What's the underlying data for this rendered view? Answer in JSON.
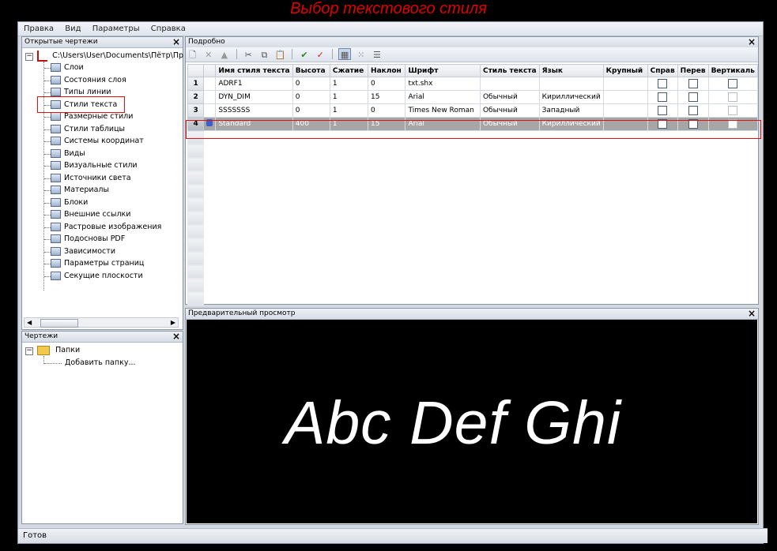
{
  "caption": "Выбор текстового стиля",
  "menu": [
    "Правка",
    "Вид",
    "Параметры",
    "Справка"
  ],
  "left_panel": {
    "title": "Открытые чертежи",
    "root_path": "C:\\Users\\User\\Documents\\Пётр\\Пр",
    "items": [
      {
        "label": "Слои",
        "icon": "layers-icon"
      },
      {
        "label": "Состояния слоя",
        "icon": "layer-states-icon"
      },
      {
        "label": "Типы линии",
        "icon": "linetypes-icon"
      },
      {
        "label": "Стили текста",
        "icon": "text-style-icon"
      },
      {
        "label": "Размерные стили",
        "icon": "dimension-style-icon"
      },
      {
        "label": "Стили таблицы",
        "icon": "table-style-icon"
      },
      {
        "label": "Системы координат",
        "icon": "ucs-icon"
      },
      {
        "label": "Виды",
        "icon": "views-icon"
      },
      {
        "label": "Визуальные стили",
        "icon": "visual-styles-icon"
      },
      {
        "label": "Источники света",
        "icon": "lights-icon"
      },
      {
        "label": "Материалы",
        "icon": "materials-icon"
      },
      {
        "label": "Блоки",
        "icon": "blocks-icon"
      },
      {
        "label": "Внешние ссылки",
        "icon": "xrefs-icon"
      },
      {
        "label": "Растровые изображения",
        "icon": "raster-images-icon"
      },
      {
        "label": "Подосновы PDF",
        "icon": "pdf-underlay-icon"
      },
      {
        "label": "Зависимости",
        "icon": "dependencies-icon"
      },
      {
        "label": "Параметры страниц",
        "icon": "page-setup-icon"
      },
      {
        "label": "Секущие плоскости",
        "icon": "section-planes-icon"
      }
    ]
  },
  "drawings_panel": {
    "title": "Чертежи",
    "folder": "Папки",
    "add_folder": "Добавить папку..."
  },
  "detail_panel": {
    "title": "Подробно",
    "columns": [
      "Имя стиля текста",
      "Высота",
      "Сжатие",
      "Наклон",
      "Шрифт",
      "Стиль текста",
      "Язык",
      "Крупный",
      "Справ",
      "Перев",
      "Вертикаль"
    ],
    "rows": [
      {
        "num": "1",
        "name": "ADRF1",
        "height": "0",
        "width": "1",
        "oblique": "0",
        "font": "txt.shx",
        "style": "",
        "lang": "",
        "big": ""
      },
      {
        "num": "2",
        "name": "DYN_DIM",
        "height": "0",
        "width": "1",
        "oblique": "15",
        "font": "Arial",
        "style": "Обычный",
        "lang": "Кириллический",
        "big": ""
      },
      {
        "num": "3",
        "name": "SSSSSSS",
        "height": "0",
        "width": "1",
        "oblique": "0",
        "font": "Times New Roman",
        "style": "Обычный",
        "lang": "Западный",
        "big": ""
      },
      {
        "num": "4",
        "name": "Standard",
        "height": "400",
        "width": "1",
        "oblique": "15",
        "font": "Arial",
        "style": "Обычный",
        "lang": "Кириллический",
        "big": ""
      }
    ],
    "selected_row": 4
  },
  "preview_panel": {
    "title": "Предварительный просмотр",
    "sample_text": "Abc Def Ghi"
  },
  "status": "Готов"
}
